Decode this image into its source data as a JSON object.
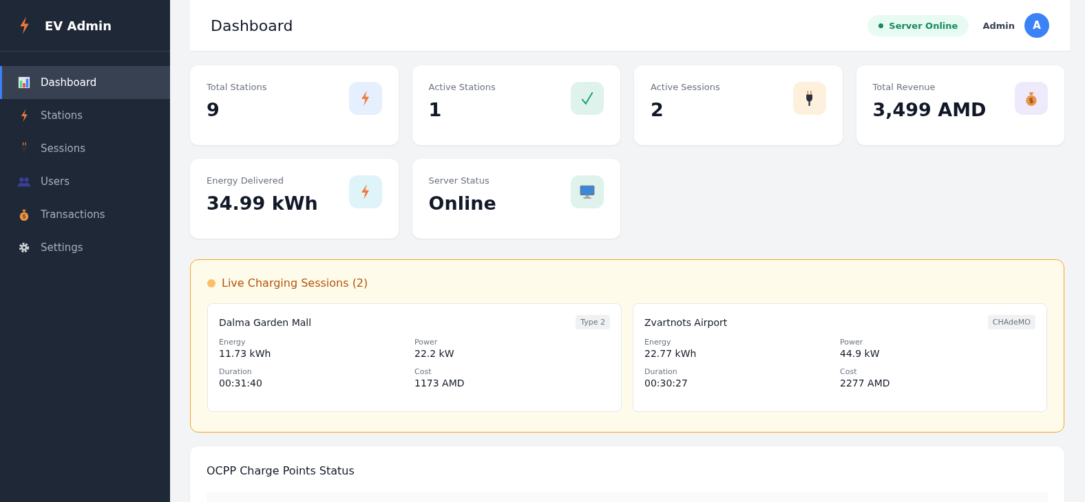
{
  "sidebar": {
    "brand": "EV Admin",
    "items": [
      {
        "label": "Dashboard",
        "kind": "chart",
        "selected": true
      },
      {
        "label": "Stations",
        "kind": "bolt",
        "selected": false
      },
      {
        "label": "Sessions",
        "kind": "plug",
        "selected": false
      },
      {
        "label": "Users",
        "kind": "users",
        "selected": false
      },
      {
        "label": "Transactions",
        "kind": "money",
        "selected": false
      },
      {
        "label": "Settings",
        "kind": "gear",
        "selected": false
      }
    ]
  },
  "header": {
    "title": "Dashboard",
    "server_status": {
      "label": "Server Online",
      "online": true
    },
    "user": {
      "name": "Admin",
      "initial": "A"
    }
  },
  "stats": [
    {
      "label": "Total Stations",
      "value": "9",
      "kind": "bolt"
    },
    {
      "label": "Active Stations",
      "value": "1",
      "kind": "check"
    },
    {
      "label": "Active Sessions",
      "value": "2",
      "kind": "plug"
    },
    {
      "label": "Total Revenue",
      "value": "3,499 AMD",
      "kind": "money"
    },
    {
      "label": "Energy Delivered",
      "value": "34.99 kWh",
      "kind": "energy"
    },
    {
      "label": "Server Status",
      "value": "Online",
      "kind": "server"
    }
  ],
  "live_sessions": {
    "title": "Live Charging Sessions (2)",
    "sessions": [
      {
        "station": "Dalma Garden Mall",
        "connector": "Type 2",
        "metrics": [
          {
            "label": "Energy",
            "value": "11.73 kWh"
          },
          {
            "label": "Power",
            "value": "22.2 kW"
          },
          {
            "label": "Duration",
            "value": "00:31:40"
          },
          {
            "label": "Cost",
            "value": "1173 AMD"
          }
        ]
      },
      {
        "station": "Zvartnots Airport",
        "connector": "CHAdeMO",
        "metrics": [
          {
            "label": "Energy",
            "value": "22.77 kWh"
          },
          {
            "label": "Power",
            "value": "44.9 kW"
          },
          {
            "label": "Duration",
            "value": "00:30:27"
          },
          {
            "label": "Cost",
            "value": "2277 AMD"
          }
        ]
      }
    ]
  },
  "ocpp": {
    "title": "OCPP Charge Points Status"
  }
}
